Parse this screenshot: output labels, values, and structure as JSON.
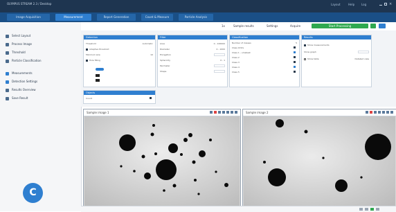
{
  "window": {
    "title": "OLYMPUS STREAM 2.3 / Desktop"
  },
  "header": {
    "controls": [
      "Layout",
      "Help",
      "Log"
    ]
  },
  "tabs": [
    {
      "label": "Image Acquisition",
      "active": false
    },
    {
      "label": "Measurement",
      "active": true
    },
    {
      "label": "Report Generation",
      "active": false
    },
    {
      "label": "Count & Measure",
      "active": false
    },
    {
      "label": "Particle Analysis",
      "active": false
    }
  ],
  "sidebar": {
    "items": [
      {
        "label": "Select Layout",
        "icon": "layout-icon"
      },
      {
        "label": "Process Image",
        "icon": "process-icon"
      },
      {
        "label": "Threshold",
        "icon": "threshold-icon"
      },
      {
        "label": "Particle Classification",
        "icon": "classify-icon"
      },
      {
        "label": "Measurements",
        "icon": "measure-icon"
      },
      {
        "label": "Detection Settings",
        "icon": "detect-icon"
      },
      {
        "label": "Results Overview",
        "icon": "table-icon"
      },
      {
        "label": "Save Result",
        "icon": "save-icon"
      }
    ],
    "badge": "C"
  },
  "toolbar": {
    "zoom": "1x",
    "options": [
      "Sample results",
      "Settings",
      "Acquire"
    ],
    "run_label": "Start Processing",
    "colors": {
      "run": "#2fa84f",
      "accent": "#2f7fd0"
    }
  },
  "panels": {
    "detection": {
      "title": "Detection",
      "rows": [
        "Threshold",
        "Adaptive threshold",
        "Minimum size",
        "Hole filling"
      ],
      "values": [
        "Automatic",
        "",
        "10",
        ""
      ]
    },
    "filter": {
      "title": "Filter",
      "rows": [
        "Area",
        "Diameter",
        "Elongation",
        "Sphericity",
        "Perimeter",
        "Shape"
      ],
      "values": [
        "0 - 100000",
        "0 - 1000",
        "",
        "0 - 1",
        "",
        ""
      ]
    },
    "classification": {
      "title": "Classification",
      "rows": [
        "Number of classes",
        "Class limits",
        "Class 1 – smallest",
        "Class 2",
        "Class 3",
        "Class 4",
        "Class 5"
      ],
      "values": [
        "5",
        "",
        "",
        "",
        "",
        "",
        ""
      ]
    },
    "result": {
      "title": "Results",
      "rows": [
        "Show measurements",
        "Show graph",
        "Show table"
      ],
      "values": [
        "",
        "",
        "Detailed view"
      ]
    },
    "extra": {
      "title": "Objects",
      "rows": [
        "Count"
      ],
      "values": [
        ""
      ]
    }
  },
  "viewers": [
    {
      "title": "Sample image 1"
    },
    {
      "title": "Sample image 2"
    }
  ]
}
